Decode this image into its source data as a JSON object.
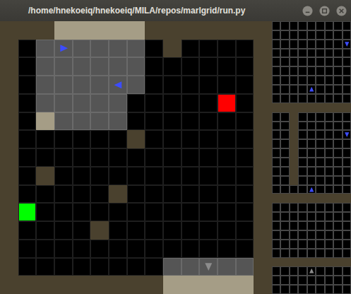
{
  "window": {
    "title": "/home/hnekoeiq/hnekoeiq/MILA/repos/marlgrid/run.py"
  },
  "main_grid": {
    "rows": [
      "WWWhhhhhWWWWWWW",
      "W.gggggg.W....W",
      "W.gggggg......W",
      "W.gggggg......W",
      "W.ggggg.......W",
      "W.hgggg.......W",
      "W......W......W",
      "W.............W",
      "W.W...........W",
      "W.....W.......W",
      "W.............W",
      "W....W........W",
      "W.............W",
      "W........gggggW",
      "WWWWWWWWWhhhhhW"
    ],
    "objects": [
      {
        "kind": "lava",
        "row": 4,
        "col": 12,
        "color": "#ff0000"
      },
      {
        "kind": "goal",
        "row": 10,
        "col": 1,
        "color": "#00ff00"
      }
    ],
    "agents": [
      {
        "row": 1,
        "col": 3,
        "direction": "right",
        "color": "#3c4cff",
        "active": true
      },
      {
        "row": 3,
        "col": 6,
        "direction": "left",
        "color": "#3c4cff",
        "active": true
      },
      {
        "row": 13,
        "col": 11,
        "direction": "down",
        "color": "#8c8c8c",
        "active": false
      }
    ]
  },
  "agent_views": [
    {
      "rows": [
        ".........",
        ".........",
        ".........",
        ".........",
        ".........",
        ".........",
        ".........",
        ".........",
        ".........",
        "WWWWWWWWW"
      ],
      "agents": [
        {
          "row": 2,
          "col": 8,
          "direction": "down",
          "color": "#3c4cff"
        },
        {
          "row": 7,
          "col": 4,
          "direction": "up",
          "color": "#3c4cff"
        }
      ]
    },
    {
      "rows": [
        "..W......",
        "..W......",
        "..W......",
        "..W......",
        "..W......",
        "..W......",
        "..W......",
        "..W......",
        ".........",
        "WWWWWWWWW"
      ],
      "agents": [
        {
          "row": 2,
          "col": 8,
          "direction": "down",
          "color": "#3c4cff"
        },
        {
          "row": 8,
          "col": 4,
          "direction": "up",
          "color": "#3c4cff"
        }
      ]
    },
    {
      "rows": [
        ".........",
        ".........",
        ".........",
        ".........",
        ".........",
        ".........",
        "WWWWWWWWW",
        ".........",
        ".........",
        "........."
      ],
      "agents": [
        {
          "row": 7,
          "col": 4,
          "direction": "up",
          "color": "#8c8c8c"
        }
      ]
    }
  ]
}
